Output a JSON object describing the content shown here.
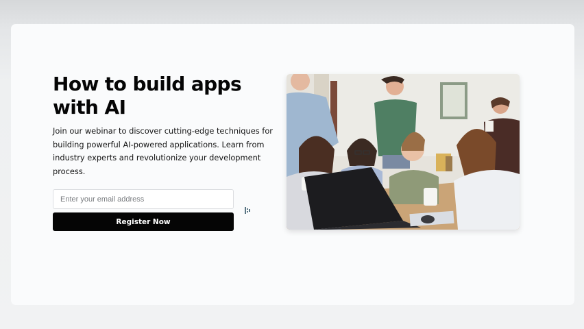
{
  "hero": {
    "title": "How to build apps with AI",
    "description": "Join our webinar to discover cutting-edge techniques for building powerful AI-powered applications. Learn from industry experts and revolutionize your development process.",
    "email_placeholder": "Enter your email address",
    "register_label": "Register Now"
  },
  "image": {
    "subject": "Group of people working together around a laptop"
  },
  "colors": {
    "button_bg": "#050505",
    "card_bg": "#fafbfc",
    "text": "#050505"
  },
  "icons": {
    "cursor": "grip-cursor-icon"
  }
}
